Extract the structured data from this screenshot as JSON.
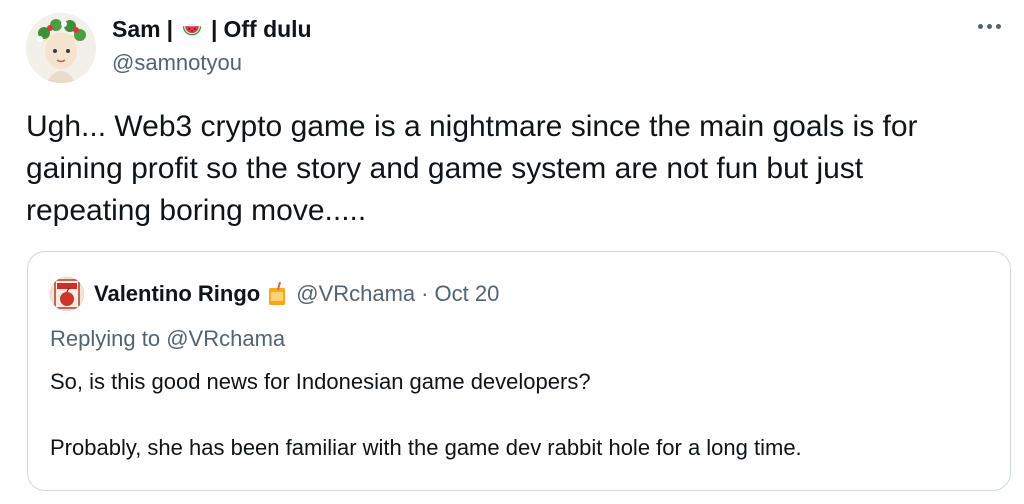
{
  "author": {
    "name_part1": "Sam",
    "separator1": "|",
    "emoji_icon": "watermelon-icon",
    "separator2": "|",
    "name_part2": "Off dulu",
    "handle": "@samnotyou"
  },
  "menu": {
    "icon": "more-icon"
  },
  "tweet": {
    "lines": [
      "Ugh... Web3 crypto game is a nightmare since the main goals is for",
      "gaining profit so the story and game system are not fun but just",
      "repeating boring move....."
    ]
  },
  "quote": {
    "name": "Valentino Ringo",
    "emoji_icon": "juice-box-icon",
    "handle": "@VRchama",
    "dot": "·",
    "date": "Oct 20",
    "replying_prefix": "Replying to",
    "replying_handle": "@VRchama",
    "paragraphs": [
      "So, is this good news for Indonesian game developers?",
      "Probably, she has been familiar with the game dev rabbit hole for a long time."
    ]
  },
  "colors": {
    "text": "#0f1419",
    "secondary": "#536471",
    "border": "#cfd9de"
  }
}
